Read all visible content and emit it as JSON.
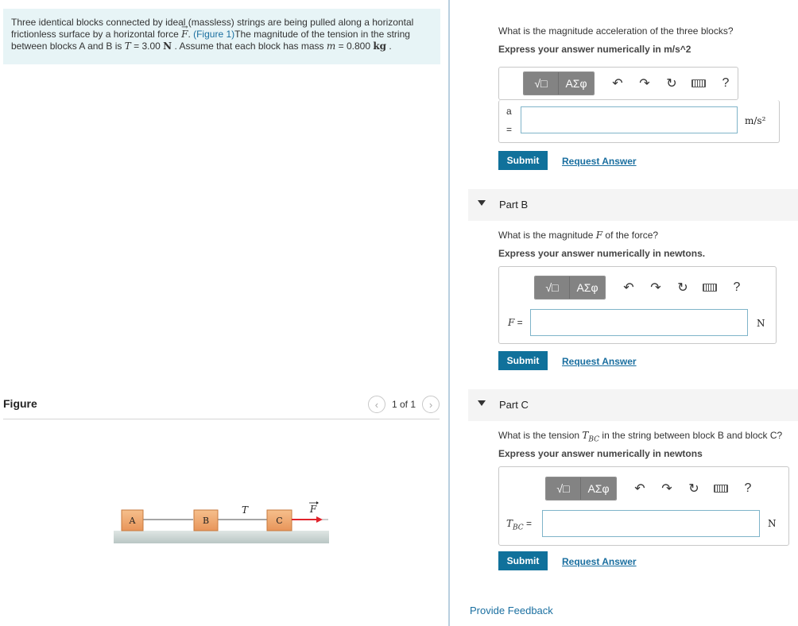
{
  "problem": {
    "text_1": "Three identical blocks connected by ideal (massless) strings are being pulled along a horizontal frictionless surface by a horizontal force ",
    "force_symbol": "F",
    "text_2": ". ",
    "figure_link": "(Figure 1)",
    "text_3": "The magnitude of the tension in the string between blocks A and B is ",
    "tension_symbol": "T",
    "tension_value": " = 3.00 ",
    "tension_unit": "N",
    "text_4": " . Assume that each block has mass ",
    "mass_symbol": "m",
    "mass_value": " = 0.800 ",
    "mass_unit": "kg",
    "text_5": " ."
  },
  "figure": {
    "title": "Figure",
    "pager_text": "1 of 1",
    "prev_icon": "chevron-left-icon",
    "next_icon": "chevron-right-icon",
    "block_labels": [
      "A",
      "B",
      "C"
    ],
    "tension_label": "T",
    "force_label": "F",
    "block_color": "#f2a56a",
    "floor_color": "#c9d6d4",
    "arrow_color": "#e0232b"
  },
  "toolbar": {
    "template_symbol": "√□",
    "greek_label": "ΑΣφ",
    "undo_icon": "undo-icon",
    "redo_icon": "redo-icon",
    "reset_icon": "reset-icon",
    "keyboard_icon": "keyboard-icon",
    "help_label": "?"
  },
  "partA": {
    "question": "What is the magnitude acceleration of the three blocks?",
    "instruction": "Express your answer numerically in m/s^2",
    "label_var": "a",
    "label_eq": "=",
    "input_value": "",
    "unit": "m/s²",
    "submit_label": "Submit",
    "request_label": "Request Answer"
  },
  "partB": {
    "title": "Part B",
    "question_1": "What is the magnitude ",
    "question_var": "F",
    "question_2": " of the force?",
    "instruction": "Express your answer numerically in newtons.",
    "label_var": "F",
    "label_eq": " =",
    "input_value": "",
    "unit": "N",
    "submit_label": "Submit",
    "request_label": "Request Answer"
  },
  "partC": {
    "title": "Part C",
    "question_1": "What is the tension ",
    "question_var": "T",
    "question_sub": "BC",
    "question_2": " in the string between block B and block C?",
    "instruction": "Express your answer numerically in newtons",
    "label_var": "T",
    "label_sub": "BC",
    "label_eq": " =",
    "input_value": "",
    "unit": "N",
    "submit_label": "Submit",
    "request_label": "Request Answer"
  },
  "feedback_label": "Provide Feedback"
}
